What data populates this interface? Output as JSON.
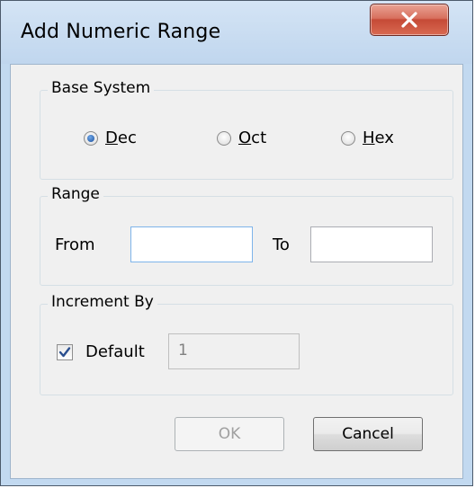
{
  "dialog": {
    "title": "Add Numeric Range"
  },
  "base_system": {
    "label": "Base System",
    "options": [
      {
        "label": "Dec",
        "selected": true
      },
      {
        "label": "Oct",
        "selected": false
      },
      {
        "label": "Hex",
        "selected": false
      }
    ]
  },
  "range": {
    "label": "Range",
    "from_label": "From",
    "from_value": "",
    "to_label": "To",
    "to_value": ""
  },
  "increment": {
    "label": "Increment By",
    "default_label": "Default",
    "default_checked": true,
    "value": "1"
  },
  "buttons": {
    "ok": "OK",
    "cancel": "Cancel"
  },
  "colors": {
    "frame": "#c2d9f0",
    "close_button": "#c54a36",
    "radio_selected": "#1c4f9a"
  }
}
